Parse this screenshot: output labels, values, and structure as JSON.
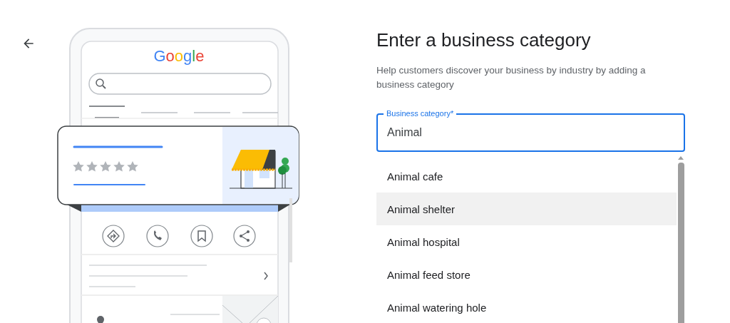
{
  "illustration": {
    "logo": "Google"
  },
  "heading": "Enter a business category",
  "description": "Help customers discover your business by industry by adding a business category",
  "field": {
    "label": "Business category*",
    "value": "Animal"
  },
  "suggestions": [
    {
      "label": "Animal cafe",
      "selected": false
    },
    {
      "label": "Animal shelter",
      "selected": true
    },
    {
      "label": "Animal hospital",
      "selected": false
    },
    {
      "label": "Animal feed store",
      "selected": false
    },
    {
      "label": "Animal watering hole",
      "selected": false
    }
  ]
}
